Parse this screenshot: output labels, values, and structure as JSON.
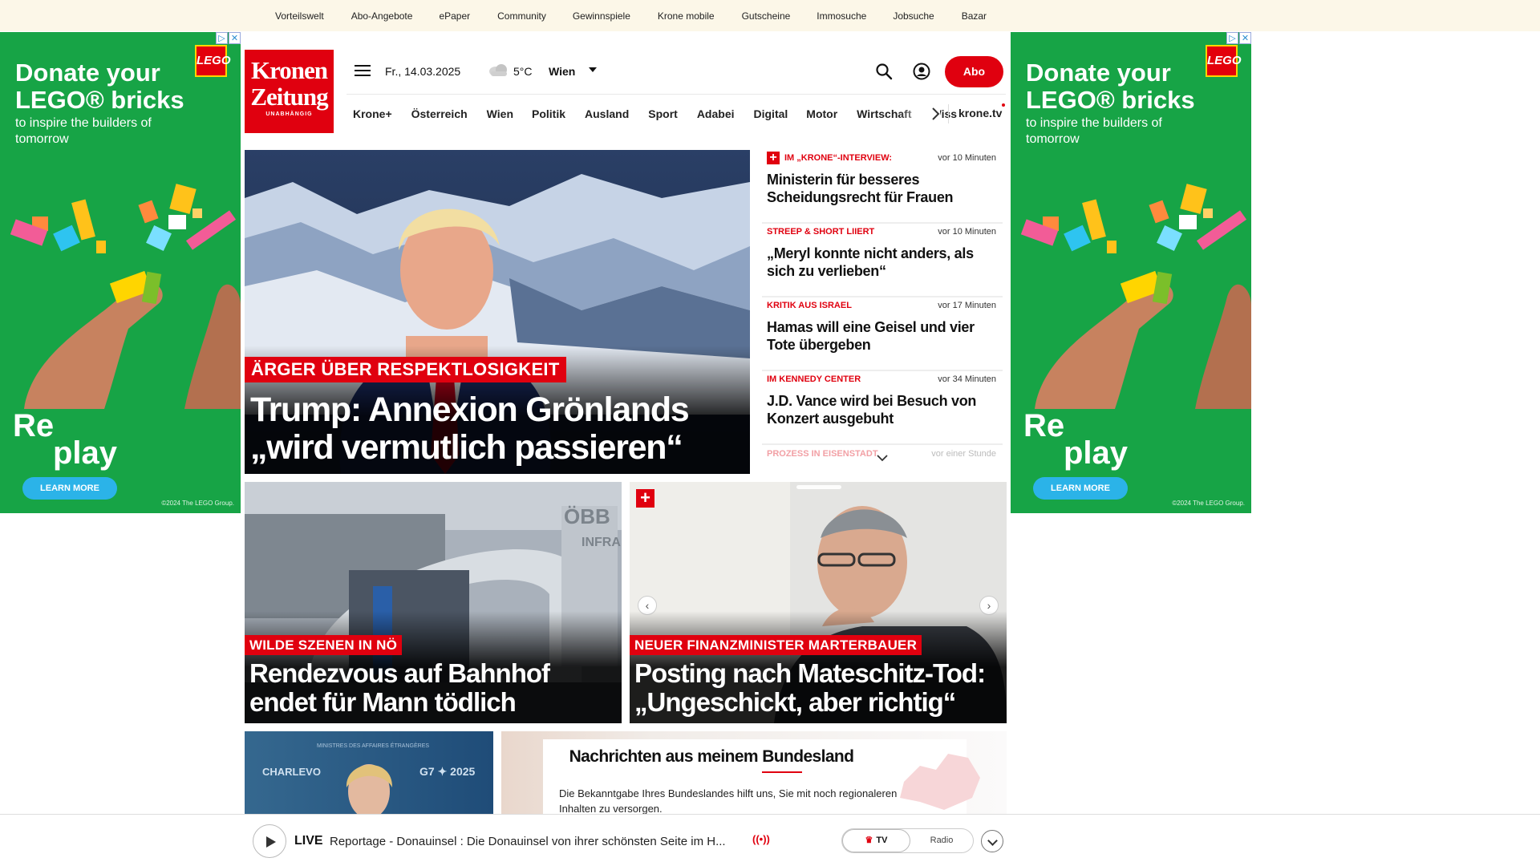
{
  "topbar": {
    "links": [
      "Vorteilswelt",
      "Abo-Angebote",
      "ePaper",
      "Community",
      "Gewinnspiele",
      "Krone mobile",
      "Gutscheine",
      "Immosuche",
      "Jobsuche",
      "Bazar"
    ]
  },
  "ads": {
    "headline": "Donate your LEGO® bricks",
    "subline": "to inspire the builders of tomorrow",
    "replay_1": "Re",
    "replay_2": "play",
    "cta": "LEARN MORE",
    "copyright": "©2024 The LEGO Group.",
    "brand": "LEGO"
  },
  "header": {
    "logo_line1": "Kronen",
    "logo_line2": "Zeitung",
    "logo_line3": "UNABHÄNGIG",
    "date": "Fr., 14.03.2025",
    "temperature": "5°C",
    "city": "Wien",
    "abo_label": "Abo"
  },
  "nav": {
    "items": [
      "Krone+",
      "Österreich",
      "Wien",
      "Politik",
      "Ausland",
      "Sport",
      "Adabei",
      "Digital",
      "Motor",
      "Wirtschaft",
      "Wiss"
    ],
    "tv_label": "krone.tv"
  },
  "hero": {
    "kicker": "ÄRGER ÜBER RESPEKTLOSIGKEIT",
    "title": "Trump: Annexion Grönlands „wird vermutlich passieren“"
  },
  "ticker": [
    {
      "kicker": "IM „KRONE“-INTERVIEW:",
      "time": "vor 10 Minuten",
      "title": "Ministerin für besseres Scheidungsrecht für Frauen",
      "plus": true
    },
    {
      "kicker": "STREEP & SHORT LIIERT",
      "time": "vor 10 Minuten",
      "title": "„Meryl konnte nicht anders, als sich zu verlieben“",
      "plus": false
    },
    {
      "kicker": "KRITIK AUS ISRAEL",
      "time": "vor 17 Minuten",
      "title": "Hamas will eine Geisel und vier Tote übergeben",
      "plus": false
    },
    {
      "kicker": "IM KENNEDY CENTER",
      "time": "vor 34 Minuten",
      "title": "J.D. Vance wird bei Besuch von Konzert ausgebuht",
      "plus": false
    }
  ],
  "ticker_faded": {
    "kicker": "PROZESS IN EISENSTADT",
    "time": "vor einer Stunde"
  },
  "tiles": [
    {
      "kicker": "WILDE SZENEN IN NÖ",
      "title": "Rendezvous auf Bahnhof endet für Mann tödlich",
      "sign_1": "ÖBB",
      "sign_2": "INFRA"
    },
    {
      "kicker": "NEUER FINANZMINISTER MARTERBAUER",
      "title": "Posting nach Mateschitz-Tod: „Ungeschickt, aber richtig“"
    }
  ],
  "small_tile": {
    "text_1": "CHARLEVO",
    "text_2": "G7 ✦ 2025",
    "text_3": "MINISTRES DES AFFAIRES ÉTRANGÈRES"
  },
  "bundesland": {
    "title": "Nachrichten aus meinem Bundesland",
    "text": "Die Bekanntgabe Ihres Bundeslandes hilft uns, Sie mit noch regionaleren Inhalten zu versorgen."
  },
  "livebar": {
    "live_label": "LIVE",
    "text": "Reportage - Donauinsel : Die Donauinsel von ihrer schönsten Seite im H...",
    "radio_icon": "((•))",
    "tv_label": "TV",
    "radio_label": "Radio"
  },
  "colors": {
    "brand_red": "#e0000f",
    "ad_green": "#17a446",
    "topbar_bg": "#fcf7e8"
  }
}
